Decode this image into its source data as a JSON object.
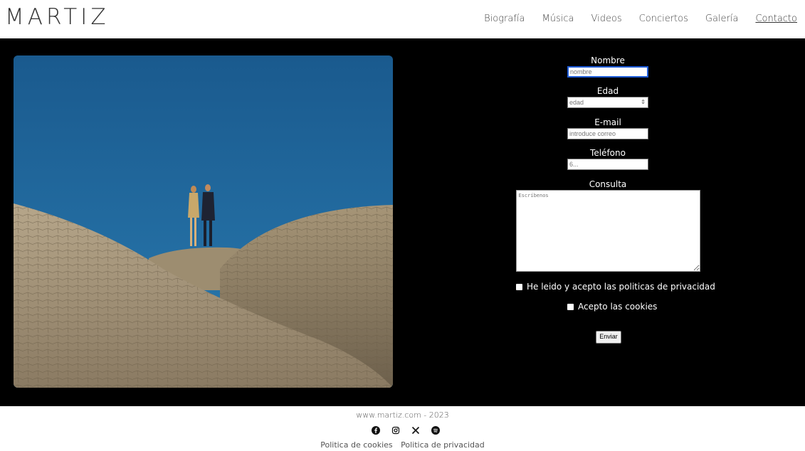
{
  "header": {
    "logo": "MARTIZ",
    "nav": [
      "Biografía",
      "Música",
      "Videos",
      "Conciertos",
      "Galería",
      "Contacto"
    ]
  },
  "form": {
    "name_label": "Nombre",
    "name_placeholder": "nombre",
    "age_label": "Edad",
    "age_placeholder": "edad",
    "email_label": "E-mail",
    "email_placeholder": "introduce correo",
    "phone_label": "Teléfono",
    "phone_placeholder": "6...",
    "query_label": "Consulta",
    "query_placeholder": "Escríbenos",
    "privacy_label": "He leido y acepto las politicas de privacidad",
    "cookies_label": "Acepto las cookies",
    "submit_label": "Enviar"
  },
  "footer": {
    "copyright": "www.martiz.com - 2023",
    "social_icons": [
      "facebook-icon",
      "instagram-icon",
      "x-icon",
      "spotify-icon"
    ],
    "links": [
      "Politica de cookies",
      "Politica de privacidad"
    ]
  },
  "colors": {
    "main_bg": "#000000",
    "focus_border": "#1e5bd6",
    "sky": "#1f5f8f"
  }
}
